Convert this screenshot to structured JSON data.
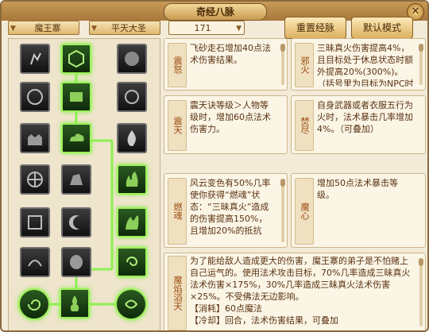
{
  "window": {
    "title": "奇经八脉",
    "close_icon": "close-icon"
  },
  "toolbar": {
    "school": "魔王寨",
    "path": "平天大圣",
    "points": "171",
    "reset_label": "重置经脉",
    "default_label": "默认模式"
  },
  "skills": {
    "zhennu": {
      "name": "震怒",
      "text": "飞砂走石增加40点法术伤害结果。"
    },
    "xiehuo": {
      "name": "邪火",
      "text": "三昧真火伤害提高4%，且目标处于休息状态时额外提高20%(300%)。（括号里为目标为NPC时的效果"
    },
    "zhentian": {
      "name": "震天",
      "text": "震天诀等级＞人物等级时，增加60点法术伤害力。"
    },
    "fenchen": {
      "name": "焚尽",
      "text": "自身武器或者衣服五行为火时，法术暴击几率增加4%。（可叠加）"
    },
    "ranhun": {
      "name": "燃魂",
      "text": "风云变色有50%几率使你获得“燃魂”状态：“三昧真火”造成的伤害提高150%，且增加20%的抵抗"
    },
    "moxin": {
      "name": "魔心",
      "text": "增加50点法术暴击等级。"
    },
    "moyan": {
      "name": "魔焰滔天",
      "text": "为了能给敌人造成更大的伤害，魔王寨的弟子是不怕赌上自己运气的。使用法术攻击目标，70%几率造成三昧真火法术伤害×175%，30%几率造成三昧真火法术伤害×25%。不受佛法无边影响。",
      "cost": "【消耗】60点魔法",
      "extra": "【冷却】回合，法术伤害结果，可叠加"
    }
  },
  "colors": {
    "active_glow": "#7cf040",
    "label_text": "#9c4a10",
    "body_text": "#5a3212"
  }
}
